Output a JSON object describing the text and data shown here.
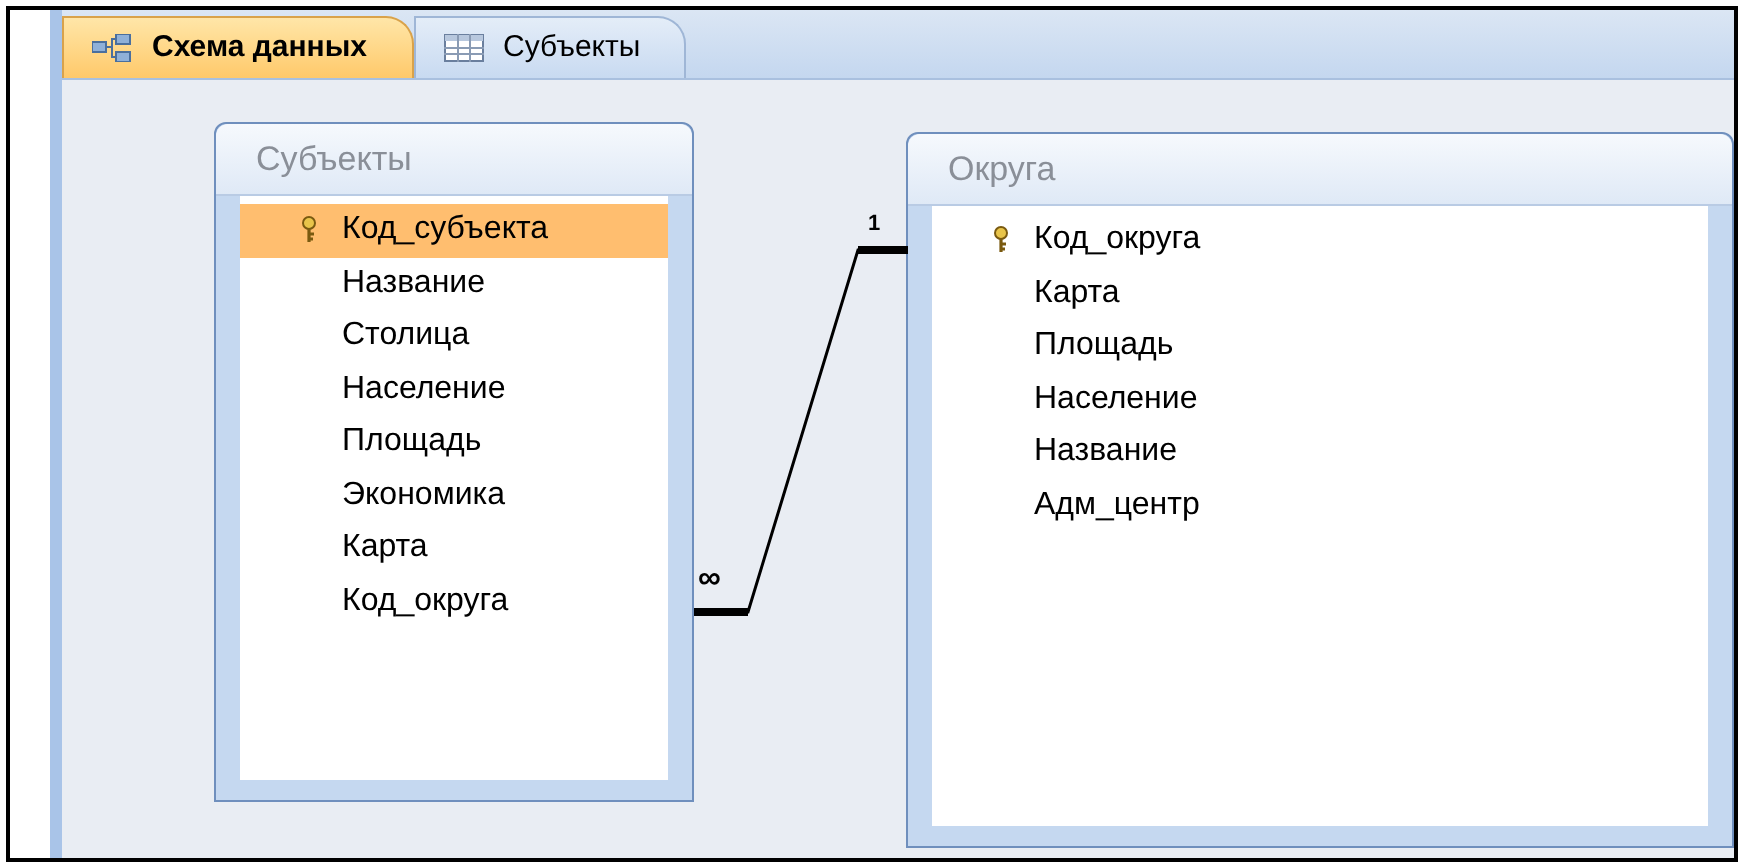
{
  "tabs": [
    {
      "label": "Схема данных",
      "kind": "diagram",
      "selected": true
    },
    {
      "label": "Субъекты",
      "kind": "table",
      "selected": false
    }
  ],
  "tables": [
    {
      "title": "Субъекты",
      "fields": [
        {
          "name": "Код_субъекта",
          "key": true,
          "selected": true
        },
        {
          "name": "Название",
          "key": false,
          "selected": false
        },
        {
          "name": "Столица",
          "key": false,
          "selected": false
        },
        {
          "name": "Население",
          "key": false,
          "selected": false
        },
        {
          "name": "Площадь",
          "key": false,
          "selected": false
        },
        {
          "name": "Экономика",
          "key": false,
          "selected": false
        },
        {
          "name": "Карта",
          "key": false,
          "selected": false
        },
        {
          "name": "Код_округа",
          "key": false,
          "selected": false
        }
      ]
    },
    {
      "title": "Округа",
      "fields": [
        {
          "name": "Код_округа",
          "key": true,
          "selected": false
        },
        {
          "name": "Карта",
          "key": false,
          "selected": false
        },
        {
          "name": "Площадь",
          "key": false,
          "selected": false
        },
        {
          "name": "Население",
          "key": false,
          "selected": false
        },
        {
          "name": "Название",
          "key": false,
          "selected": false
        },
        {
          "name": "Адм_центр",
          "key": false,
          "selected": false
        }
      ]
    }
  ],
  "relationship": {
    "many_label": "∞",
    "one_label": "1"
  }
}
